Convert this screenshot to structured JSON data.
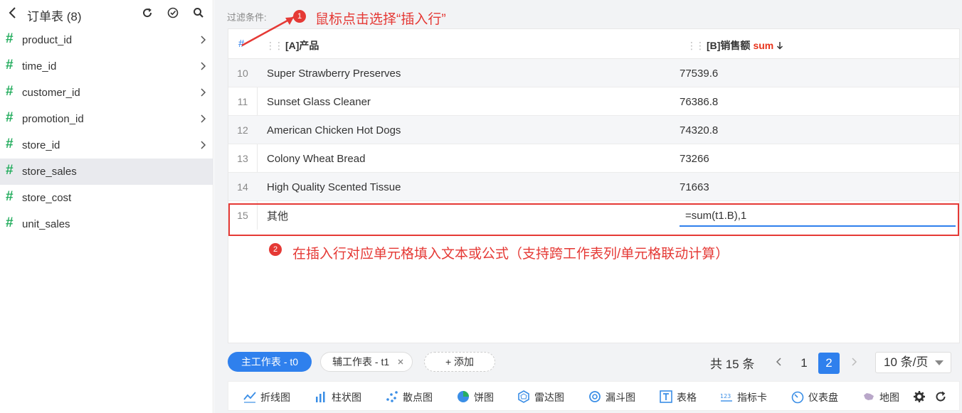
{
  "sidebar": {
    "title": "订单表 (8)",
    "fields": [
      {
        "label": "product_id"
      },
      {
        "label": "time_id"
      },
      {
        "label": "customer_id"
      },
      {
        "label": "promotion_id"
      },
      {
        "label": "store_id"
      },
      {
        "label": "store_sales"
      },
      {
        "label": "store_cost"
      },
      {
        "label": "unit_sales"
      }
    ],
    "hash_symbol": "#"
  },
  "filter_label": "过滤条件:",
  "table": {
    "num_header": "#",
    "col_a_header": "[A]产品",
    "col_b_header": "[B]销售额",
    "sum_tag": "sum",
    "rows": [
      {
        "num": "10",
        "a": "Super Strawberry Preserves",
        "b": "77539.6"
      },
      {
        "num": "11",
        "a": "Sunset Glass Cleaner",
        "b": "76386.8"
      },
      {
        "num": "12",
        "a": "American Chicken Hot Dogs",
        "b": "74320.8"
      },
      {
        "num": "13",
        "a": "Colony Wheat Bread",
        "b": "73266"
      },
      {
        "num": "14",
        "a": "High Quality Scented Tissue",
        "b": "71663"
      }
    ],
    "insert_row": {
      "num": "15",
      "a": "其他",
      "formula": "=sum(t1.B),1"
    }
  },
  "annotations": {
    "step1_badge": "1",
    "step1_text": "鼠标点击选择“插入行”",
    "step2_badge": "2",
    "step2_text": "在插入行对应单元格填入文本或公式（支持跨工作表列/单元格联动计算）",
    "accent_color": "#e53935"
  },
  "tabs": {
    "main": "主工作表 - t0",
    "aux": "辅工作表 - t1",
    "add": "+ 添加"
  },
  "pager": {
    "total": "共 15 条",
    "pages": [
      "1",
      "2"
    ],
    "current": "2",
    "page_size": "10 条/页"
  },
  "charts": [
    {
      "label": "折线图",
      "icon": "line-chart-icon"
    },
    {
      "label": "柱状图",
      "icon": "bar-chart-icon"
    },
    {
      "label": "散点图",
      "icon": "scatter-chart-icon"
    },
    {
      "label": "饼图",
      "icon": "pie-chart-icon"
    },
    {
      "label": "雷达图",
      "icon": "radar-chart-icon"
    },
    {
      "label": "漏斗图",
      "icon": "funnel-chart-icon"
    },
    {
      "label": "表格",
      "icon": "table-icon"
    },
    {
      "label": "指标卡",
      "icon": "metric-card-icon"
    },
    {
      "label": "仪表盘",
      "icon": "gauge-icon"
    },
    {
      "label": "地图",
      "icon": "map-icon"
    }
  ],
  "colors": {
    "primary": "#2f80ed",
    "hash_green": "#27ae60",
    "sum_red": "#e8341c"
  }
}
